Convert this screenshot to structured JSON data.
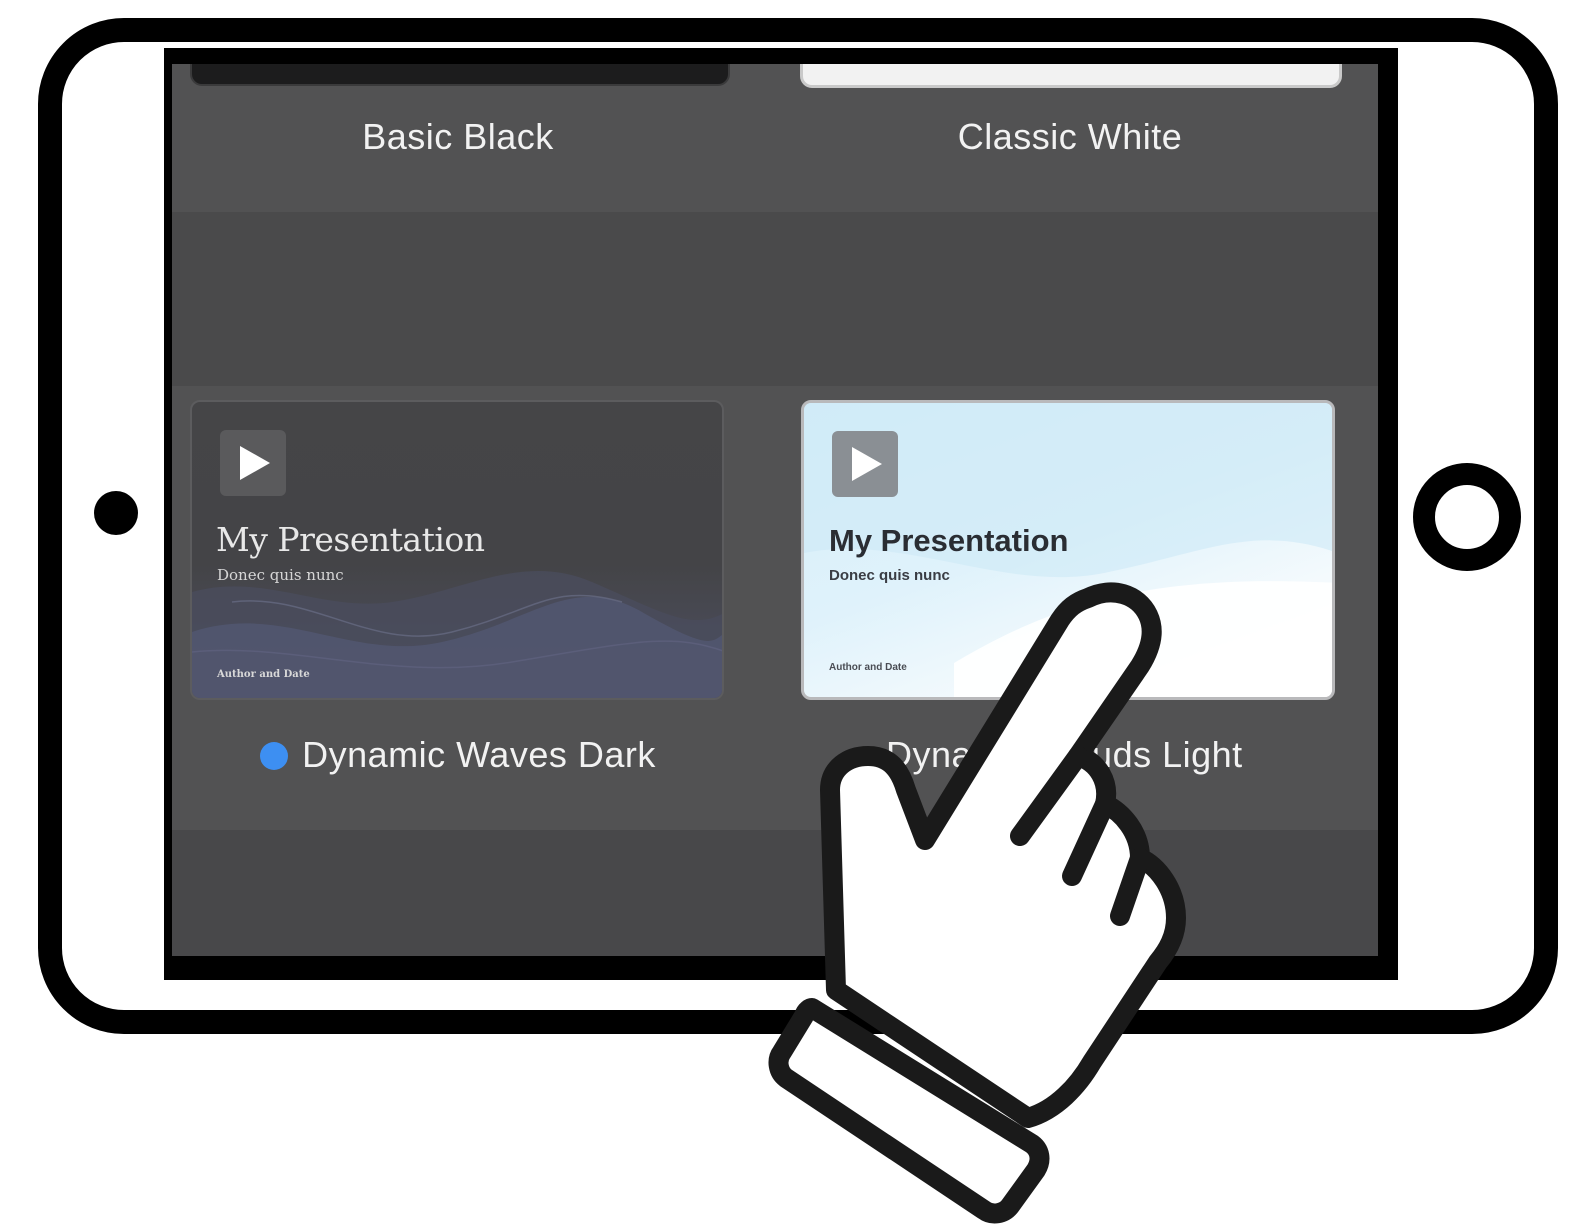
{
  "screen": {
    "themes_row_top": [
      {
        "name": "Basic Black"
      },
      {
        "name": "Classic White"
      }
    ],
    "themes_row_main": [
      {
        "name": "Dynamic Waves Dark",
        "selected": true,
        "preview": {
          "title": "My Presentation",
          "subtitle": "Donec quis nunc",
          "footer": "Author and Date",
          "icon": "play-icon"
        }
      },
      {
        "name": "Dynamic Clouds Light",
        "visible_name": "Dyna",
        "visible_name_tail": "uds Light",
        "selected": false,
        "preview": {
          "title": "My Presentation",
          "subtitle": "Donec quis nunc",
          "footer": "Author and Date",
          "icon": "play-icon"
        }
      }
    ]
  },
  "colors": {
    "selection_dot": "#3d8ff2",
    "screen_background": "#474748"
  },
  "overlay": {
    "icon": "pointing-hand-icon"
  }
}
